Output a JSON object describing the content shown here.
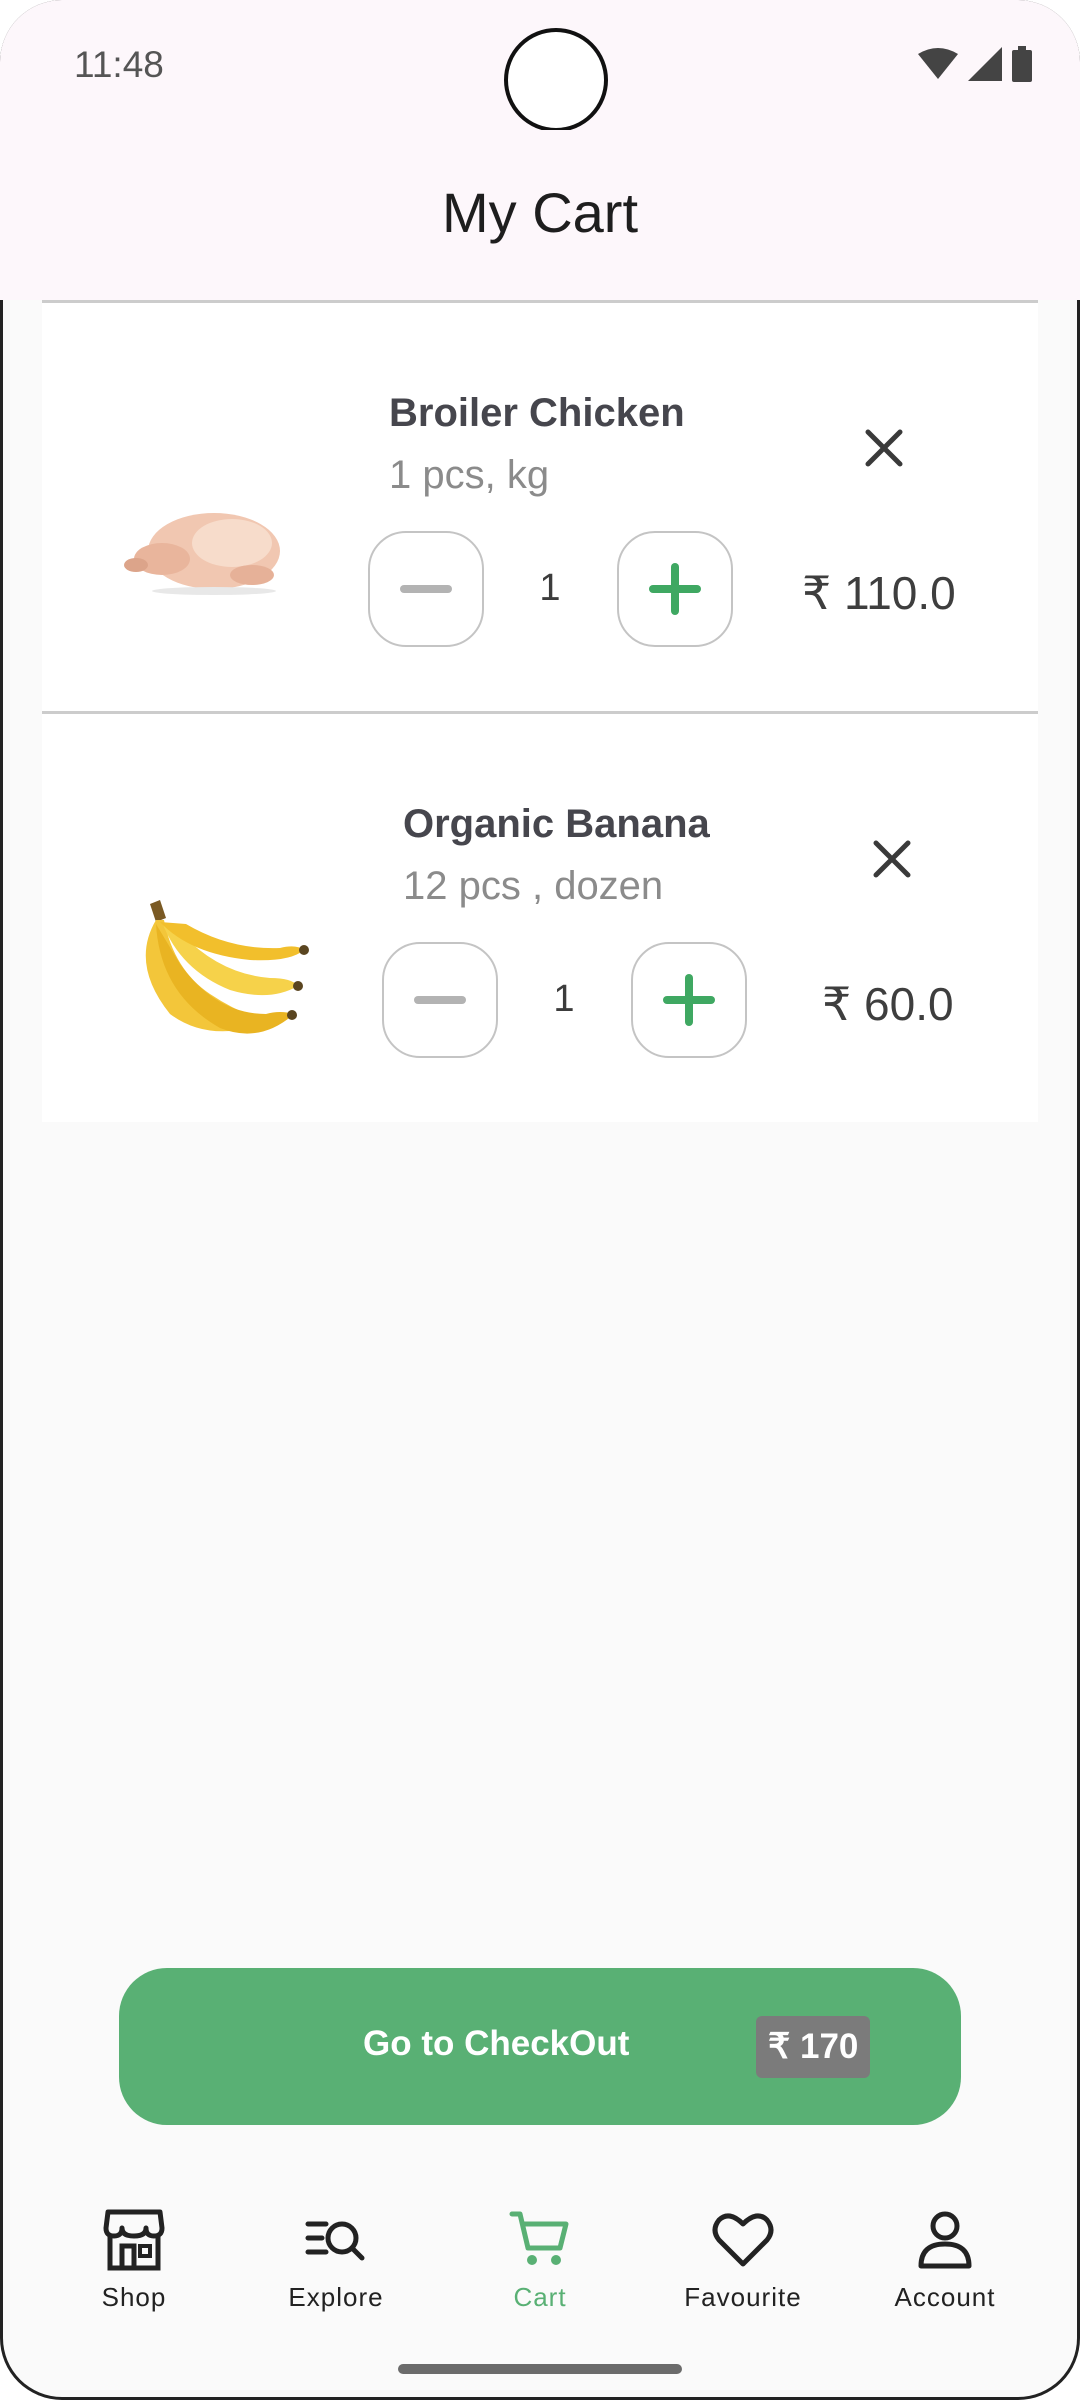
{
  "status_bar": {
    "time": "11:48"
  },
  "header": {
    "title": "My Cart"
  },
  "cart": {
    "items": [
      {
        "name": "Broiler Chicken",
        "unit": "1 pcs, kg",
        "quantity": "1",
        "price": "₹ 110.0"
      },
      {
        "name": "Organic Banana",
        "unit": "12 pcs , dozen",
        "quantity": "1",
        "price": "₹ 60.0"
      }
    ]
  },
  "checkout": {
    "label": "Go to CheckOut",
    "total": "₹ 170"
  },
  "nav": {
    "items": [
      {
        "label": "Shop",
        "icon": "store-icon"
      },
      {
        "label": "Explore",
        "icon": "explore-search-icon"
      },
      {
        "label": "Cart",
        "icon": "cart-icon",
        "active": true
      },
      {
        "label": "Favourite",
        "icon": "heart-icon"
      },
      {
        "label": "Account",
        "icon": "account-icon"
      }
    ]
  },
  "colors": {
    "accent": "#59b074",
    "text_dark": "#46464d",
    "text_muted": "#8b8b8b",
    "total_badge": "#7b7b7b"
  }
}
